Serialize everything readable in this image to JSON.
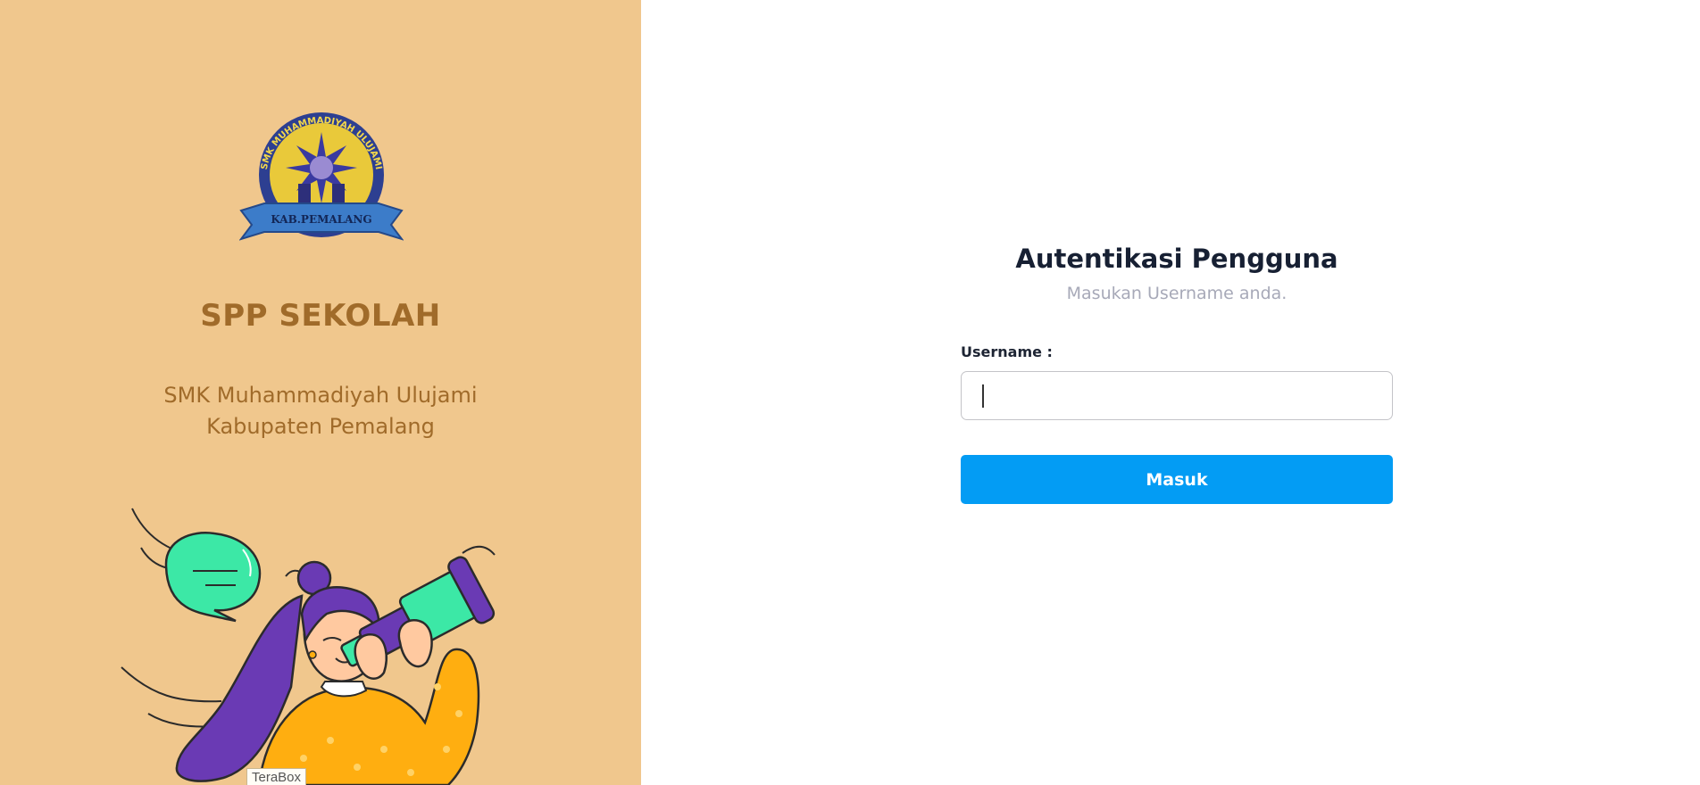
{
  "brand": {
    "title": "SPP SEKOLAH",
    "school_line1": "SMK Muhammadiyah Ulujami",
    "school_line2": "Kabupaten Pemalang",
    "logo_text_top": "SMK MUHAMMADIYAH ULUJAMI",
    "logo_text_banner": "KAB.PEMALANG"
  },
  "overlay": {
    "terabox_label": "TeraBox"
  },
  "auth": {
    "title": "Autentikasi Pengguna",
    "subtitle": "Masukan Username anda.",
    "username_label": "Username :",
    "username_value": "",
    "submit_label": "Masuk"
  },
  "colors": {
    "left_panel_bg": "#f0c78d",
    "brand_text": "#a06b2a",
    "primary_button": "#039cf4",
    "title_text": "#172033",
    "subtitle_text": "#a7a9b8"
  },
  "icons": {
    "logo": "school-logo-icon",
    "illustration": "woman-telescope-illustration",
    "speech_bubble": "speech-bubble-icon"
  }
}
